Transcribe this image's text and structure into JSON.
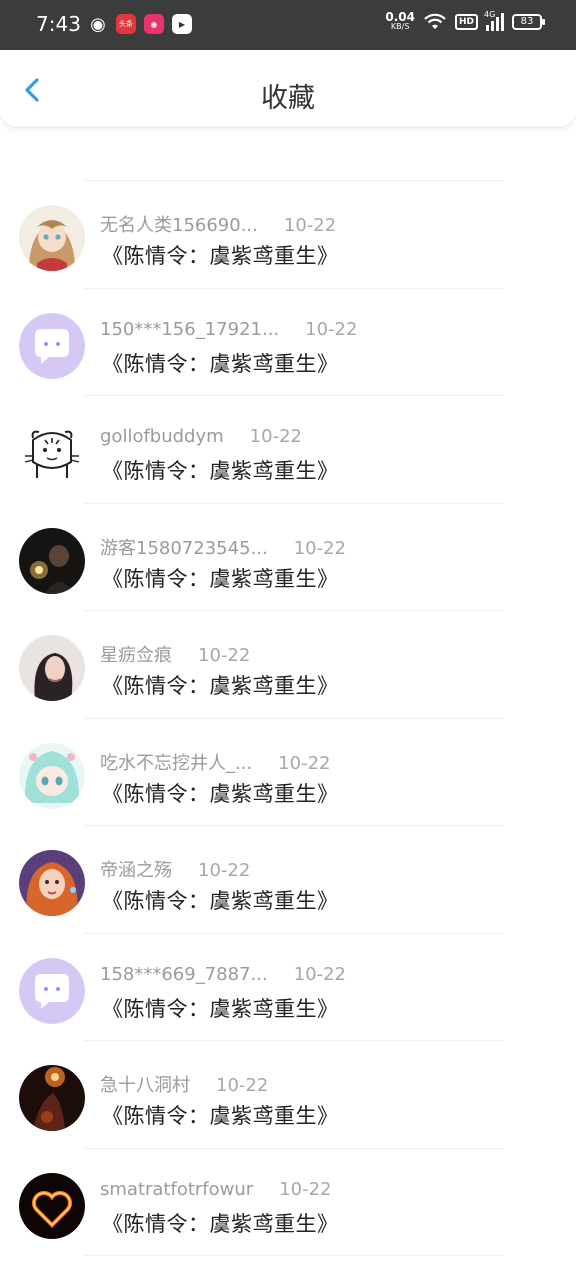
{
  "status_bar": {
    "time": "7:43",
    "app_icons": [
      "wechat-icon",
      "toutiao-icon",
      "pink-app-icon",
      "bilibili-icon"
    ],
    "toutiao_label": "头条",
    "net_speed": "0.04",
    "net_unit": "KB/S",
    "hd": "HD",
    "net_type": "4G",
    "battery": "83"
  },
  "header": {
    "title": "收藏"
  },
  "colors": {
    "accent": "#2f9ee6",
    "avatar_lavender": "#d6c8f5"
  },
  "items": [
    {
      "user": "",
      "date": "",
      "text": "《陈情令：虞紫鸢重生》",
      "avatar": "lavender"
    },
    {
      "user": "无名人类156690...",
      "date": "10-22",
      "text": "《陈情令：虞紫鸢重生》",
      "avatar": "anime-girl"
    },
    {
      "user": "150***156_17921...",
      "date": "10-22",
      "text": "《陈情令：虞紫鸢重生》",
      "avatar": "lavender"
    },
    {
      "user": "gollofbuddym",
      "date": "10-22",
      "text": "《陈情令：虞紫鸢重生》",
      "avatar": "tiger-sketch"
    },
    {
      "user": "游客1580723545...",
      "date": "10-22",
      "text": "《陈情令：虞紫鸢重生》",
      "avatar": "dark-lamp"
    },
    {
      "user": "星疬佥痕",
      "date": "10-22",
      "text": "《陈情令：虞紫鸢重生》",
      "avatar": "girl-photo"
    },
    {
      "user": "吃水不忘挖井人_...",
      "date": "10-22",
      "text": "《陈情令：虞紫鸢重生》",
      "avatar": "anime-cyan"
    },
    {
      "user": "帝涵之殇",
      "date": "10-22",
      "text": "《陈情令：虞紫鸢重生》",
      "avatar": "redhead"
    },
    {
      "user": "158***669_7887...",
      "date": "10-22",
      "text": "《陈情令：虞紫鸢重生》",
      "avatar": "lavender"
    },
    {
      "user": "急十八洞村",
      "date": "10-22",
      "text": "《陈情令：虞紫鸢重生》",
      "avatar": "dark-fire"
    },
    {
      "user": "smatratfotrfowur",
      "date": "10-22",
      "text": "《陈情令：虞紫鸢重生》",
      "avatar": "fire-heart"
    }
  ]
}
